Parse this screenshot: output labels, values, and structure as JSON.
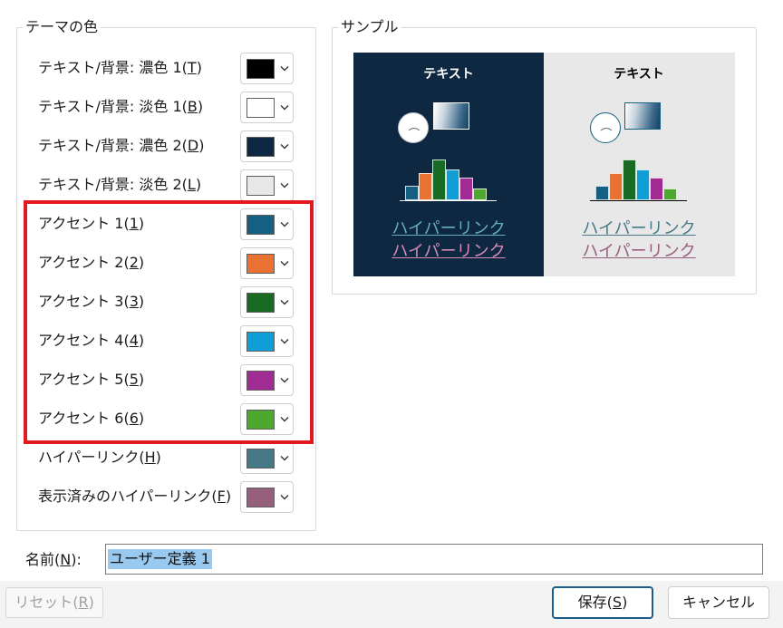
{
  "theme_colors": {
    "title": "テーマの色",
    "rows": [
      {
        "label": "テキスト/背景: 濃色 1(",
        "accel": "T",
        "end": ")",
        "color": "#000000"
      },
      {
        "label": "テキスト/背景: 淡色 1(",
        "accel": "B",
        "end": ")",
        "color": "#ffffff"
      },
      {
        "label": "テキスト/背景: 濃色 2(",
        "accel": "D",
        "end": ")",
        "color": "#0e2841"
      },
      {
        "label": "テキスト/背景: 淡色 2(",
        "accel": "L",
        "end": ")",
        "color": "#e8e8e8"
      },
      {
        "label": "アクセント 1(",
        "accel": "1",
        "end": ")",
        "color": "#156082"
      },
      {
        "label": "アクセント 2(",
        "accel": "2",
        "end": ")",
        "color": "#e97132"
      },
      {
        "label": "アクセント 3(",
        "accel": "3",
        "end": ")",
        "color": "#196b24"
      },
      {
        "label": "アクセント 4(",
        "accel": "4",
        "end": ")",
        "color": "#0f9ed5"
      },
      {
        "label": "アクセント 5(",
        "accel": "5",
        "end": ")",
        "color": "#a02b93"
      },
      {
        "label": "アクセント 6(",
        "accel": "6",
        "end": ")",
        "color": "#4ea72e"
      },
      {
        "label": "ハイパーリンク(",
        "accel": "H",
        "end": ")",
        "color": "#467886"
      },
      {
        "label": "表示済みのハイパーリンク(",
        "accel": "F",
        "end": ")",
        "color": "#96607d"
      }
    ]
  },
  "highlight": {
    "color": "#e3191f"
  },
  "sample": {
    "title": "サンプル",
    "dark": {
      "text": "テキスト",
      "hyperlink": "ハイパーリンク",
      "visited": "ハイパーリンク"
    },
    "light": {
      "text": "テキスト",
      "hyperlink": "ハイパーリンク",
      "visited": "ハイパーリンク"
    }
  },
  "name": {
    "label": "名前(",
    "accel": "N",
    "end": "):",
    "value": "ユーザー定義 1"
  },
  "buttons": {
    "reset": {
      "label": "リセット(",
      "accel": "R",
      "end": ")",
      "disabled": true
    },
    "save": {
      "label": "保存(",
      "accel": "S",
      "end": ")"
    },
    "cancel": {
      "label": "キャンセル"
    }
  },
  "icons": {
    "dropdown": "chevron-down-icon"
  }
}
